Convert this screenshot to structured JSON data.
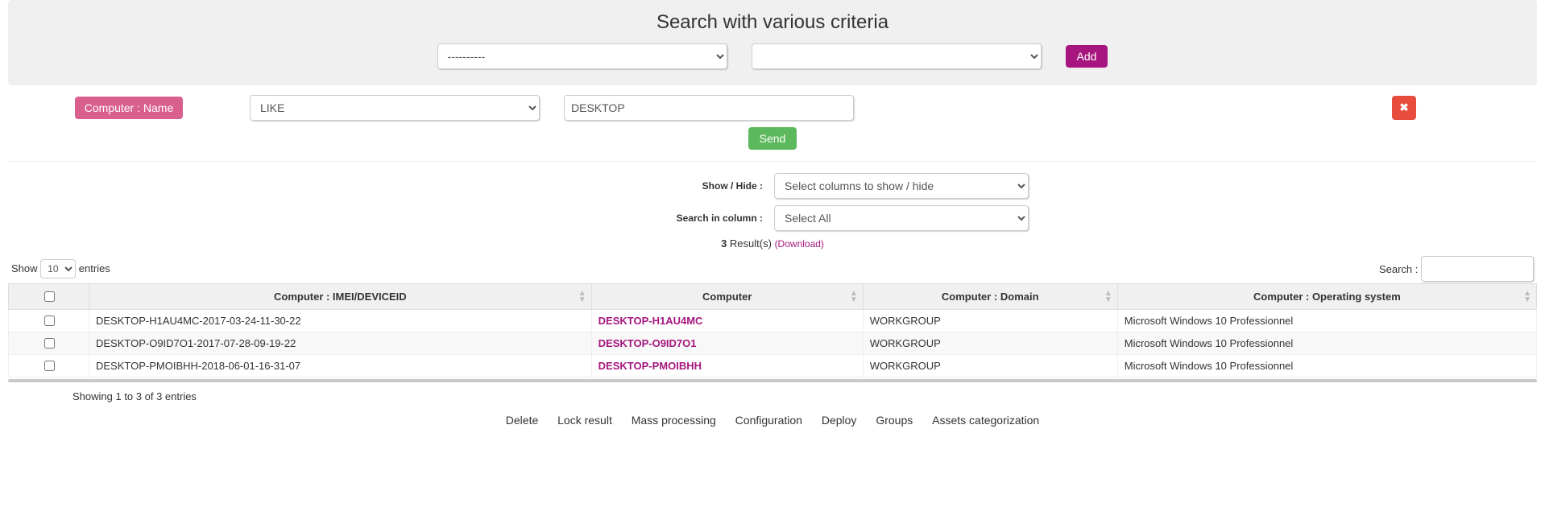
{
  "panel": {
    "title": "Search with various criteria",
    "field_ph": "----------",
    "op_ph": "",
    "add_label": "Add"
  },
  "criteria": {
    "badge": "Computer : Name",
    "operator": "LIKE",
    "value": "DESKTOP",
    "remove_icon": "✖",
    "send_label": "Send"
  },
  "controls": {
    "showhide_label": "Show / Hide :",
    "showhide_ph": "Select columns to show / hide",
    "searchcol_label": "Search in column :",
    "searchcol_ph": "Select All"
  },
  "results": {
    "count": "3",
    "word": "Result(s)",
    "download": "(Download)"
  },
  "table": {
    "show_label_a": "Show",
    "show_val": "10",
    "show_label_b": "entries",
    "search_label": "Search :",
    "headers": [
      "",
      "Computer : IMEI/DEVICEID",
      "Computer",
      "Computer : Domain",
      "Computer : Operating system"
    ],
    "rows": [
      {
        "imei": "DESKTOP-H1AU4MC-2017-03-24-11-30-22",
        "computer": "DESKTOP-H1AU4MC",
        "domain": "WORKGROUP",
        "os": "Microsoft Windows 10 Professionnel"
      },
      {
        "imei": "DESKTOP-O9ID7O1-2017-07-28-09-19-22",
        "computer": "DESKTOP-O9ID7O1",
        "domain": "WORKGROUP",
        "os": "Microsoft Windows 10 Professionnel"
      },
      {
        "imei": "DESKTOP-PMOIBHH-2018-06-01-16-31-07",
        "computer": "DESKTOP-PMOIBHH",
        "domain": "WORKGROUP",
        "os": "Microsoft Windows 10 Professionnel"
      }
    ],
    "footer": "Showing 1 to 3 of 3 entries"
  },
  "actions": [
    "Delete",
    "Lock result",
    "Mass processing",
    "Configuration",
    "Deploy",
    "Groups",
    "Assets categorization"
  ]
}
